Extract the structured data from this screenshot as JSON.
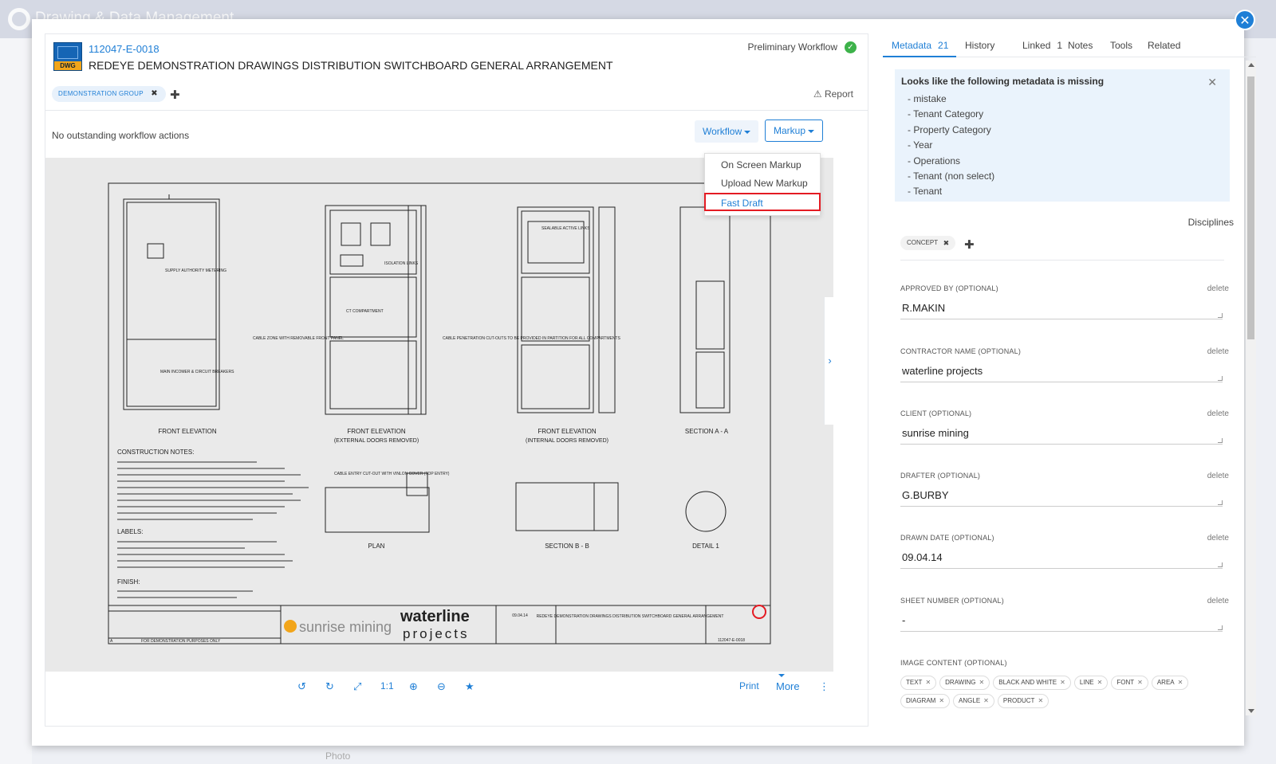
{
  "background": {
    "app_title": "Drawing & Data Management",
    "peek_text": "Photo"
  },
  "document": {
    "number": "112047-E-0018",
    "title": "REDEYE DEMONSTRATION DRAWINGS DISTRIBUTION SWITCHBOARD GENERAL ARRANGEMENT",
    "file_type": "DWG",
    "workflow_name": "Preliminary Workflow",
    "group_tag": "DEMONSTRATION GROUP",
    "report_label": "Report",
    "workflow_actions_text": "No outstanding workflow actions",
    "workflow_button": "Workflow",
    "markup_button": "Markup"
  },
  "markup_menu": {
    "items": [
      "On Screen Markup",
      "Upload New Markup",
      "Fast Draft"
    ]
  },
  "viewer_toolbar": {
    "actual_size": "1:1",
    "print": "Print",
    "more": "More"
  },
  "drawing": {
    "views": [
      "FRONT ELEVATION",
      "FRONT ELEVATION",
      "FRONT ELEVATION",
      "SECTION A - A",
      "PLAN",
      "SECTION B - B",
      "DETAIL 1"
    ],
    "view_subtitles": [
      "(EXTERNAL DOORS REMOVED)",
      "(INTERNAL DOORS REMOVED)"
    ],
    "notes_heading": "CONSTRUCTION NOTES:",
    "labels_heading": "LABELS:",
    "finish_heading": "FINISH:",
    "callouts": [
      "SUPPLY AUTHORITY METERING",
      "MAIN INCOMER & CIRCUIT BREAKERS",
      "CABLE ZONE WITH REMOVABLE FRONT PANEL",
      "ISOLATION LINKS",
      "CT COMPARTMENT",
      "CABLE PENETRATION CUT-OUTS TO BE PROVIDED IN PARTITION FOR ALL COMPARTMENTS",
      "SEALABLE ACTIVE LINKS",
      "CABLE ENTRY CUT-OUT WITH VINLON COVER (TOP ENTRY)"
    ],
    "title_block": {
      "client": "sunrise mining",
      "contractor_logo_top": "waterline",
      "contractor_logo_bottom": "projects",
      "drawing_title": "REDEYE DEMONSTRATION DRAWINGS DISTRIBUTION SWITCHBOARD GENERAL ARRANGEMENT",
      "drawing_no": "112047-E-0018",
      "revision": "A",
      "revision_note": "FOR DEMONSTRATION PURPOSES ONLY",
      "date": "09.04.14"
    }
  },
  "right_panel": {
    "tabs": [
      {
        "label": "Metadata",
        "count": "21"
      },
      {
        "label": "History",
        "count": ""
      },
      {
        "label": "Linked",
        "count": "1"
      },
      {
        "label": "Notes",
        "count": ""
      },
      {
        "label": "Tools",
        "count": ""
      },
      {
        "label": "Related",
        "count": ""
      }
    ],
    "missing_title": "Looks like the following metadata is missing",
    "missing_items": [
      "- mistake",
      "- Tenant Category",
      "- Property Category",
      "- Year",
      "- Operations",
      "- Tenant (non select)",
      "- Tenant"
    ],
    "disciplines_label": "Disciplines",
    "discipline_tag": "CONCEPT",
    "delete_label": "delete",
    "fields": [
      {
        "label": "APPROVED BY (OPTIONAL)",
        "value": "R.MAKIN"
      },
      {
        "label": "CONTRACTOR NAME (OPTIONAL)",
        "value": "waterline projects"
      },
      {
        "label": "CLIENT (OPTIONAL)",
        "value": "sunrise mining"
      },
      {
        "label": "DRAFTER (OPTIONAL)",
        "value": "G.BURBY"
      },
      {
        "label": "DRAWN DATE (OPTIONAL)",
        "value": "09.04.14"
      },
      {
        "label": "SHEET NUMBER (OPTIONAL)",
        "value": "-"
      }
    ],
    "image_content_label": "IMAGE CONTENT (OPTIONAL)",
    "image_tags": [
      "TEXT",
      "DRAWING",
      "BLACK AND WHITE",
      "LINE",
      "FONT",
      "AREA",
      "DIAGRAM",
      "ANGLE",
      "PRODUCT"
    ]
  },
  "colors": {
    "accent": "#1f7fd6",
    "highlight_box": "#e41b23",
    "success": "#3db24a",
    "warning_logo": "#f2a51a"
  },
  "icons": {
    "close": "close-icon",
    "check": "check-circle-icon",
    "warning": "warning-icon",
    "rotate_left": "rotate-left-icon",
    "rotate_right": "rotate-right-icon",
    "fullscreen": "fullscreen-icon",
    "zoom_in": "zoom-in-icon",
    "zoom_out": "zoom-out-icon",
    "star": "star-icon"
  }
}
